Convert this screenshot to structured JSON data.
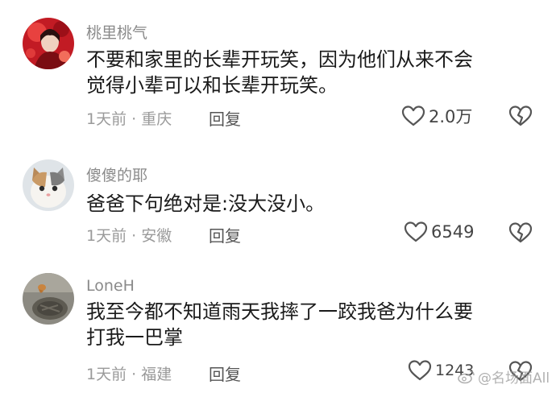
{
  "comments": [
    {
      "username": "桃里桃气",
      "text_line1": "不要和家里的长辈开玩笑，因为他们从来不会",
      "text_line2": "觉得小辈可以和长辈开玩笑。",
      "time": "1天前",
      "separator": "·",
      "location": "重庆",
      "reply_label": "回复",
      "likes": "2.0万"
    },
    {
      "username": "傻傻的耶",
      "text_line1": "爸爸下句绝对是:没大没小。",
      "time": "1天前",
      "separator": "·",
      "location": "安徽",
      "reply_label": "回复",
      "likes": "6549"
    },
    {
      "username": "LoneH",
      "text_line1": "我至今都不知道雨天我摔了一跤我爸为什么要",
      "text_line2": "打我一巴掌",
      "time": "1天前",
      "separator": "·",
      "location": "福建",
      "reply_label": "回复",
      "likes": "1243"
    }
  ],
  "watermark": {
    "text": "@名场面All"
  },
  "icons": {
    "like": "heart-outline-icon",
    "dislike": "broken-heart-icon",
    "watermark": "weibo-logo-icon"
  },
  "colors": {
    "text": "#1a1a1a",
    "username": "#8a8a8a",
    "meta": "#9a9a9a",
    "icon": "#555555"
  }
}
